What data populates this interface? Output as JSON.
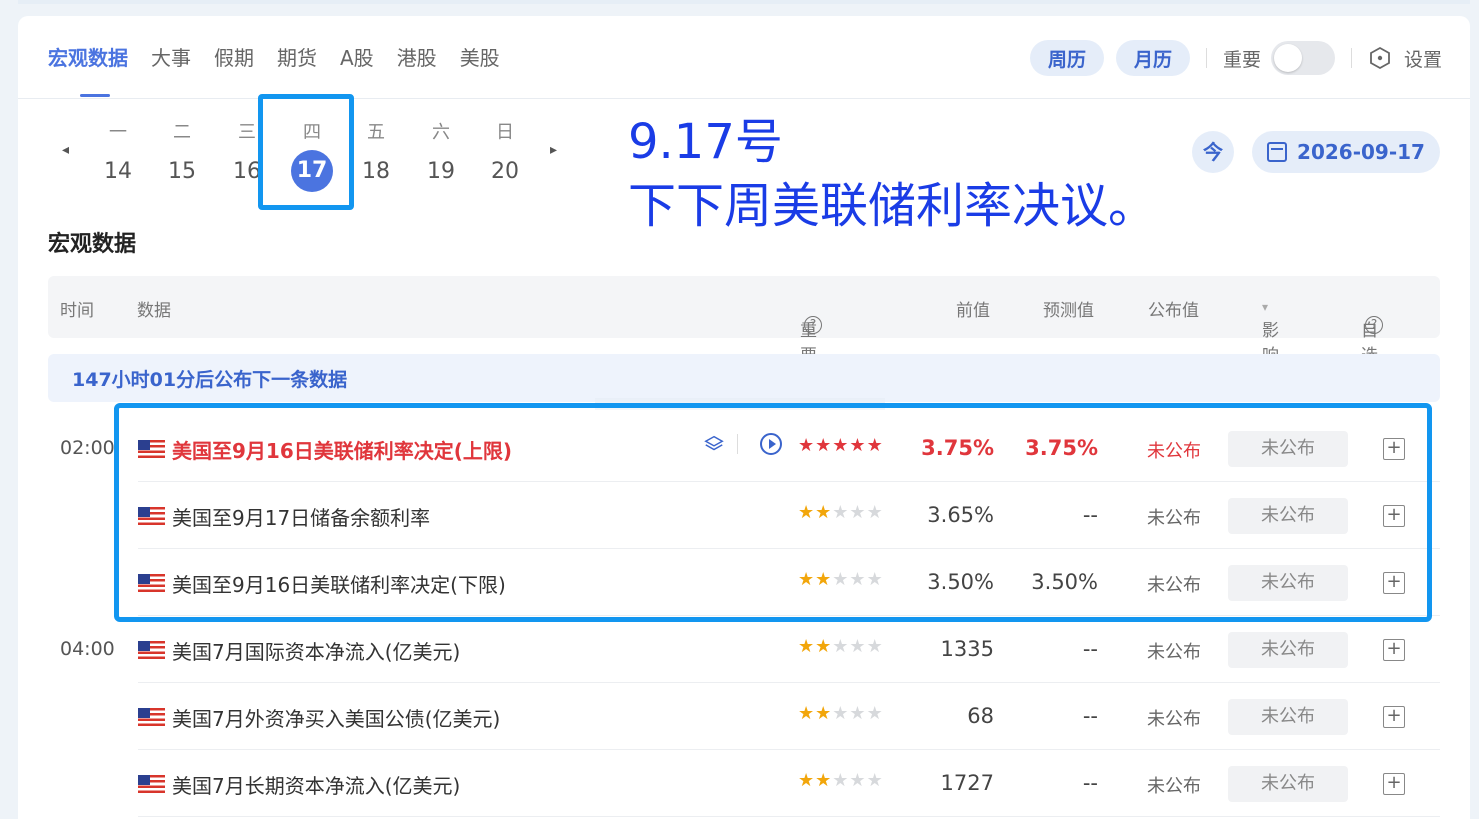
{
  "tabs": [
    "宏观数据",
    "大事",
    "假期",
    "期货",
    "A股",
    "港股",
    "美股"
  ],
  "toolbar": {
    "week_label": "周历",
    "month_label": "月历",
    "important_label": "重要",
    "settings_label": "设置"
  },
  "week": {
    "days": [
      {
        "wd": "一",
        "dn": "14"
      },
      {
        "wd": "二",
        "dn": "15"
      },
      {
        "wd": "三",
        "dn": "16"
      },
      {
        "wd": "四",
        "dn": "17"
      },
      {
        "wd": "五",
        "dn": "18"
      },
      {
        "wd": "六",
        "dn": "19"
      },
      {
        "wd": "日",
        "dn": "20"
      }
    ],
    "prev_arrow": "◂",
    "next_arrow": "▸",
    "today_label": "今",
    "current_date": "2026-09-17"
  },
  "annotation": {
    "line1": "9.17号",
    "line2": "下下周美联储利率决议。"
  },
  "section_title": "宏观数据",
  "table": {
    "headers": {
      "time": "时间",
      "data": "数据",
      "importance": "重要性",
      "prev": "前值",
      "forecast": "预测值",
      "published": "公布值",
      "impact": "影响",
      "watch": "自选"
    },
    "help_glyph": "?",
    "sort_glyph": "▾",
    "notice": "147小时01分后公布下一条数据",
    "rows": [
      {
        "time": "02:00",
        "name": "美国至9月16日美联储利率决定(上限)",
        "stars": 5,
        "prev": "3.75%",
        "forecast": "3.75%",
        "published": "未公布",
        "impact": "未公布",
        "add": "+"
      },
      {
        "time": "",
        "name": "美国至9月17日储备余额利率",
        "stars": 2,
        "prev": "3.65%",
        "forecast": "--",
        "published": "未公布",
        "impact": "未公布",
        "add": "+"
      },
      {
        "time": "",
        "name": "美国至9月16日美联储利率决定(下限)",
        "stars": 2,
        "prev": "3.50%",
        "forecast": "3.50%",
        "published": "未公布",
        "impact": "未公布",
        "add": "+"
      },
      {
        "time": "04:00",
        "name": "美国7月国际资本净流入(亿美元)",
        "stars": 2,
        "prev": "1335",
        "forecast": "--",
        "published": "未公布",
        "impact": "未公布",
        "add": "+"
      },
      {
        "time": "",
        "name": "美国7月外资净买入美国公债(亿美元)",
        "stars": 2,
        "prev": "68",
        "forecast": "--",
        "published": "未公布",
        "impact": "未公布",
        "add": "+"
      },
      {
        "time": "",
        "name": "美国7月长期资本净流入(亿美元)",
        "stars": 2,
        "prev": "1727",
        "forecast": "--",
        "published": "未公布",
        "impact": "未公布",
        "add": "+"
      }
    ]
  },
  "colors": {
    "accent": "#4b74e0",
    "highlight": "#1296f0",
    "alert": "#e0363c",
    "star": "#f2a60b"
  }
}
